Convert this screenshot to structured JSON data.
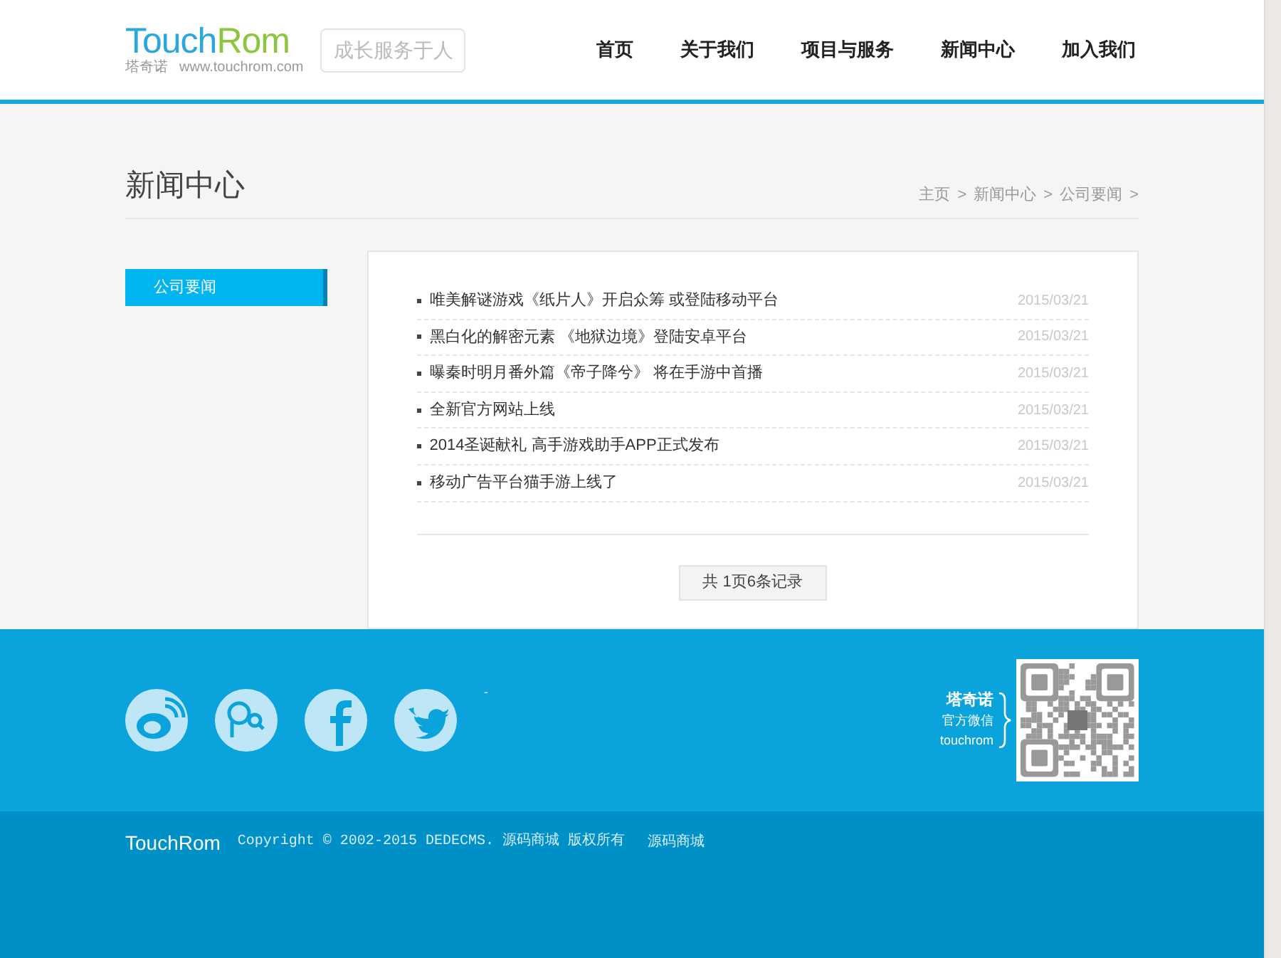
{
  "header": {
    "logo": {
      "part1": "Touch",
      "part2": "Rom",
      "tagline": "塔奇诺",
      "url": "www.touchrom.com"
    },
    "slogan": "成长服务于人",
    "nav": [
      {
        "label": "首页",
        "selected": false
      },
      {
        "label": "关于我们",
        "selected": false
      },
      {
        "label": "项目与服务",
        "selected": false
      },
      {
        "label": "新闻中心",
        "selected": false
      },
      {
        "label": "加入我们",
        "selected": false
      }
    ]
  },
  "page": {
    "title": "新闻中心",
    "breadcrumb": [
      "主页",
      "新闻中心",
      "公司要闻"
    ],
    "separator": ">"
  },
  "sidebar": {
    "items": [
      {
        "label": "公司要闻",
        "selected": true
      }
    ]
  },
  "news": [
    {
      "title": "唯美解谜游戏《纸片人》开启众筹 或登陆移动平台",
      "date": "2015/03/21"
    },
    {
      "title": "黑白化的解密元素 《地狱边境》登陆安卓平台",
      "date": "2015/03/21"
    },
    {
      "title": "曝秦时明月番外篇《帝子降兮》 将在手游中首播",
      "date": "2015/03/21"
    },
    {
      "title": "全新官方网站上线",
      "date": "2015/03/21"
    },
    {
      "title": "2014圣诞献礼 高手游戏助手APP正式发布",
      "date": "2015/03/21"
    },
    {
      "title": "移动广告平台猫手游上线了",
      "date": "2015/03/21"
    }
  ],
  "pagination": "共 1页6条记录",
  "footer": {
    "social_note": "-",
    "qr_labels": [
      "塔奇诺",
      "官方微信",
      "touchrom"
    ],
    "logo": "TouchRom",
    "copyright": "Copyright © 2002-2015 DEDECMS. 源码商城 版权所有",
    "link": "源码商城"
  }
}
